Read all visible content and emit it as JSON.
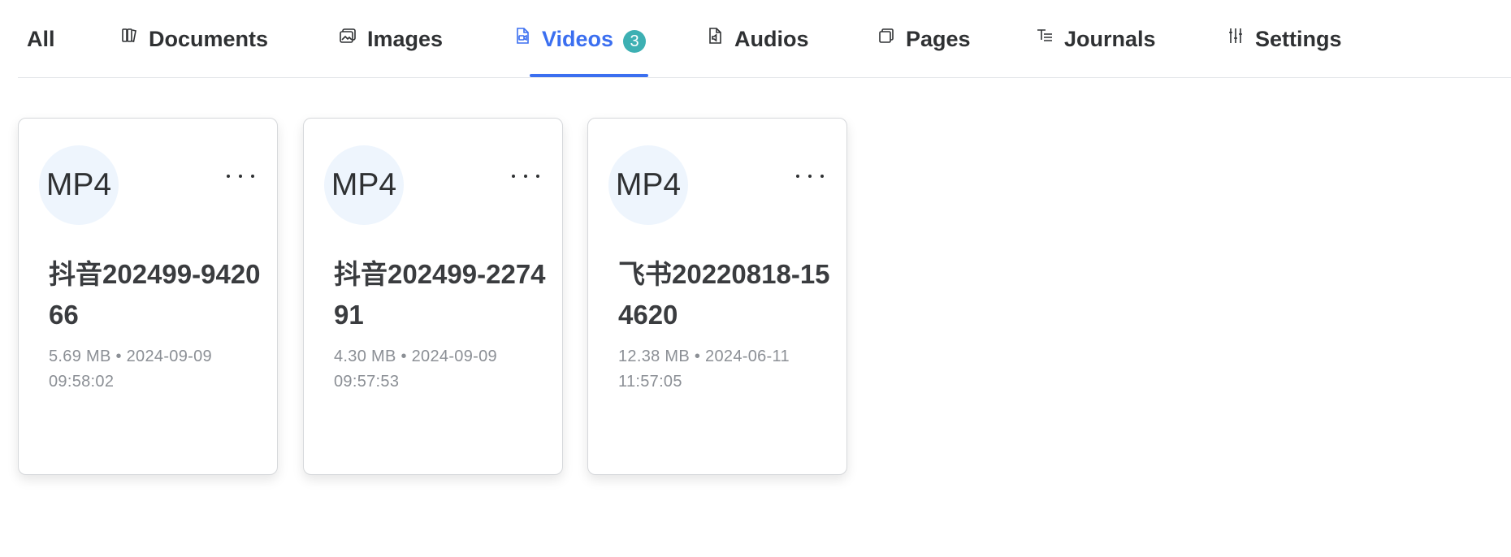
{
  "tabs": [
    {
      "label": "All",
      "icon": "none"
    },
    {
      "label": "Documents",
      "icon": "documents-icon"
    },
    {
      "label": "Images",
      "icon": "images-icon"
    },
    {
      "label": "Videos",
      "icon": "video-file-icon",
      "badge": "3"
    },
    {
      "label": "Audios",
      "icon": "audio-file-icon"
    },
    {
      "label": "Pages",
      "icon": "pages-icon"
    },
    {
      "label": "Journals",
      "icon": "journals-icon"
    },
    {
      "label": "Settings",
      "icon": "sliders-icon"
    }
  ],
  "active_tab": "Videos",
  "files": [
    {
      "type": "MP4",
      "name": "抖音202499-942066",
      "size": "5.69 MB",
      "separator": "•",
      "date": "2024-09-09",
      "time": "09:58:02"
    },
    {
      "type": "MP4",
      "name": "抖音202499-227491",
      "size": "4.30 MB",
      "separator": "•",
      "date": "2024-09-09",
      "time": "09:57:53"
    },
    {
      "type": "MP4",
      "name": "飞书20220818-154620",
      "size": "12.38 MB",
      "separator": "•",
      "date": "2024-06-11",
      "time": "11:57:05"
    }
  ],
  "colors": {
    "accent": "#3b6ff0",
    "badge": "#3db0b3",
    "file_badge_bg": "#eef5fd",
    "meta_text": "#8b8f95"
  }
}
